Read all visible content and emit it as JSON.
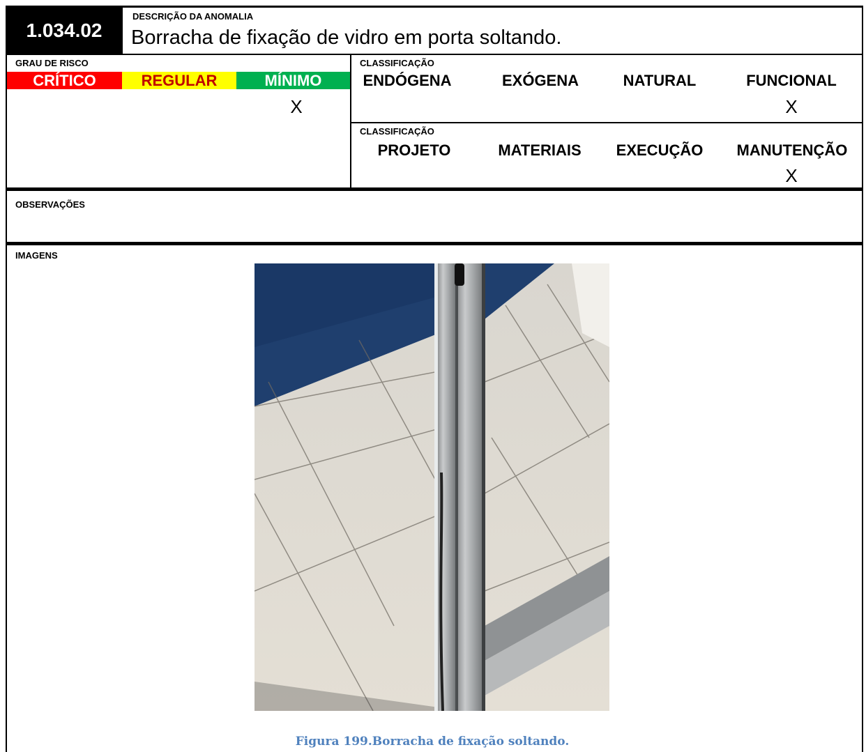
{
  "header": {
    "code": "1.034.02",
    "description_label": "DESCRIÇÃO DA ANOMALIA",
    "description": "Borracha de fixação de vidro em porta soltando."
  },
  "risk": {
    "label": "GRAU DE RISCO",
    "levels": [
      {
        "label": "CRÍTICO",
        "bg": "#ff0000",
        "fg": "#ffffff"
      },
      {
        "label": "REGULAR",
        "bg": "#ffff00",
        "fg": "#c00000"
      },
      {
        "label": "MÍNIMO",
        "bg": "#00b050",
        "fg": "#ffffff"
      }
    ],
    "selected_mark": "X"
  },
  "classification1": {
    "label": "CLASSIFICAÇÃO",
    "options": [
      "ENDÓGENA",
      "EXÓGENA",
      "NATURAL",
      "FUNCIONAL"
    ],
    "selected_mark": "X"
  },
  "classification2": {
    "label": "CLASSIFICAÇÃO",
    "options": [
      "PROJETO",
      "MATERIAIS",
      "EXECUÇÃO",
      "MANUTENÇÃO"
    ],
    "selected_mark": "X"
  },
  "observations": {
    "label": "OBSERVAÇÕES"
  },
  "images": {
    "label": "IMAGENS",
    "caption": "Figura 199.Borracha de fixação soltando.",
    "caption_color": "#4f81bd"
  }
}
